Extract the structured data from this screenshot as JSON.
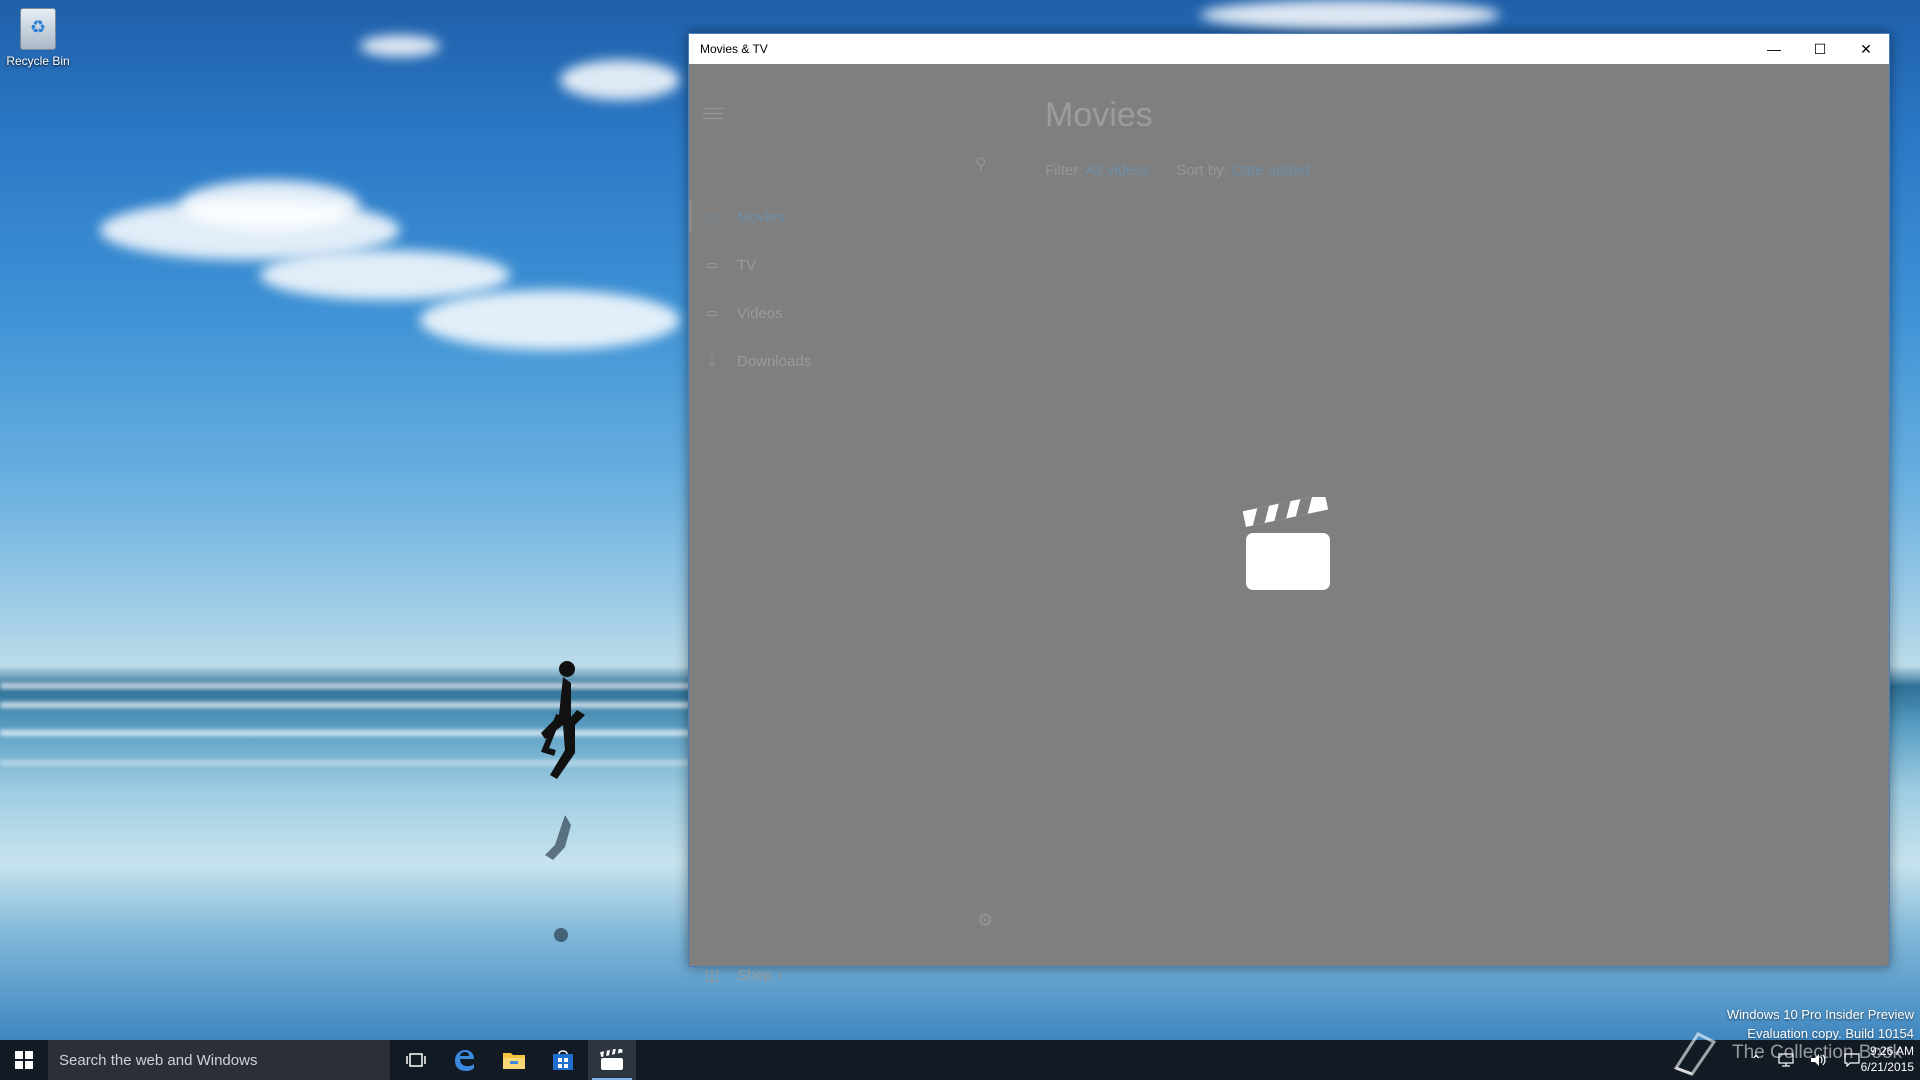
{
  "desktop": {
    "recycle_bin_label": "Recycle Bin",
    "watermark": {
      "line1": "Windows 10 Pro Insider Preview",
      "line2": "Evaluation copy. Build 10154"
    },
    "brand_logo_text": "The Collection Book"
  },
  "window": {
    "title": "Movies & TV",
    "controls": {
      "minimize": "—",
      "maximize": "☐",
      "close": "✕"
    }
  },
  "app": {
    "page_title": "Movies",
    "filter": {
      "label": "Filter:",
      "value": "All videos"
    },
    "sort": {
      "label": "Sort by:",
      "value": "Date added"
    },
    "nav": [
      {
        "label": "Movies",
        "icon": "movies-icon",
        "selected": true
      },
      {
        "label": "TV",
        "icon": "tv-icon"
      },
      {
        "label": "Videos",
        "icon": "video-camera-icon"
      },
      {
        "label": "Downloads",
        "icon": "download-icon"
      }
    ],
    "shop": {
      "label": "Shop",
      "arrow": "›"
    },
    "splash_icon": "clapperboard-icon",
    "accent_color": "#6e8ea7",
    "overlay_color": "#7f7f7f"
  },
  "taskbar": {
    "search_placeholder": "Search the web and Windows",
    "apps": [
      "start-icon",
      "task-view-icon",
      "edge-icon",
      "file-explorer-icon",
      "store-icon",
      "movies-tv-icon"
    ],
    "tray_icons": [
      "chevron-up-icon",
      "network-icon",
      "volume-icon",
      "action-center-icon"
    ],
    "time": "9:26 AM",
    "date": "6/21/2015"
  }
}
